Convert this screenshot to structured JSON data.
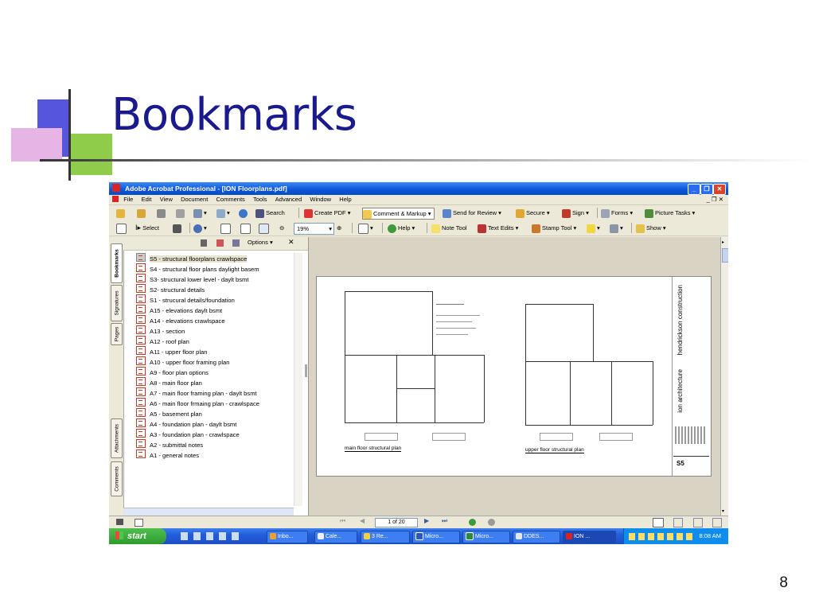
{
  "slide": {
    "title": "Bookmarks",
    "page_number": "8"
  },
  "window": {
    "title": "Adobe Acrobat Professional - [ION Floorplans.pdf]"
  },
  "menu": [
    "File",
    "Edit",
    "View",
    "Document",
    "Comments",
    "Tools",
    "Advanced",
    "Window",
    "Help"
  ],
  "toolbar1": {
    "search": "Search",
    "create_pdf": "Create PDF",
    "comment_markup": "Comment & Markup",
    "send_for_review": "Send for Review",
    "secure": "Secure",
    "sign": "Sign",
    "forms": "Forms",
    "picture_tasks": "Picture Tasks"
  },
  "toolbar2": {
    "select": "Select",
    "zoom_value": "19%",
    "help": "Help",
    "note_tool": "Note Tool",
    "text_edits": "Text Edits",
    "stamp_tool": "Stamp Tool",
    "show": "Show"
  },
  "navpane": {
    "tabs": [
      "Bookmarks",
      "Signatures",
      "Pages",
      "Attachments",
      "Comments"
    ],
    "options": "Options",
    "bookmarks": [
      "S5 - structural floorplans crawlspace",
      "S4 - structural floor plans daylight basem",
      "S3- structural lower level - daylt bsmt",
      "S2- structural details",
      "S1 - strucural details/foundation",
      "A15 - elevations daylt bsmt",
      "A14 - elevations crawlspace",
      "A13 - section",
      "A12 - roof plan",
      "A11 - upper floor plan",
      "A10 - upper floor framing plan",
      "A9 - floor plan options",
      "A8 - main floor plan",
      "A7 - main floor framing plan - daylt bsmt",
      "A6 - main floor frmaing plan - crawlspace",
      "A5 - basement plan",
      "A4 - foundation plan - daylt bsmt",
      "A3 - foundation plan - crawlspace",
      "A2 - submittal notes",
      "A1 - general notes"
    ]
  },
  "document": {
    "label_main": "main floor structural plan",
    "label_upper": "upper floor structural plan",
    "firm_a": "hendrickson construction",
    "firm_b": "ion architecture",
    "sheet": "S5"
  },
  "pager": {
    "value": "1 of 20"
  },
  "taskbar": {
    "start": "start",
    "tasks": [
      "Inbo...",
      "Cale...",
      "3 Re...",
      "Micro...",
      "Micro...",
      "DDES...",
      "ION ..."
    ],
    "clock": "8:08 AM"
  }
}
